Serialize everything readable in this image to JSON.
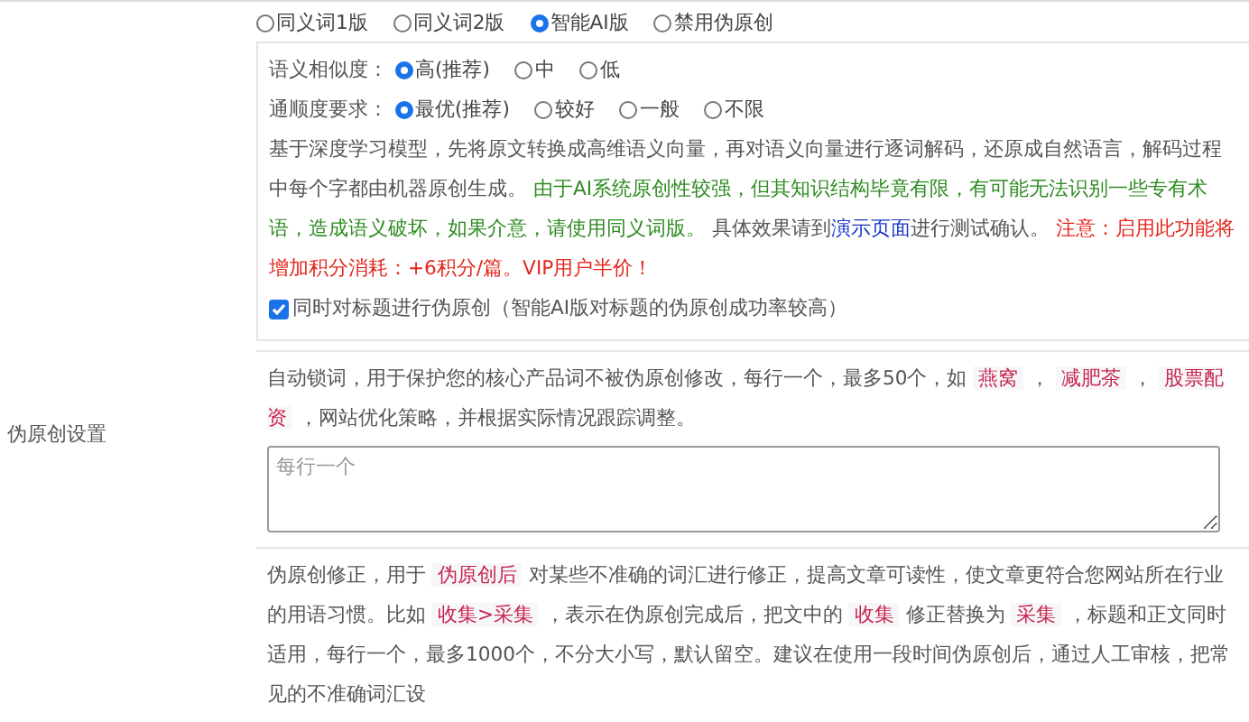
{
  "version_options": [
    {
      "label": "同义词1版",
      "selected": false
    },
    {
      "label": "同义词2版",
      "selected": false
    },
    {
      "label": "智能AI版",
      "selected": true
    },
    {
      "label": "禁用伪原创",
      "selected": false
    }
  ],
  "settings_panel": {
    "option_groups": [
      {
        "label": "语义相似度：",
        "options": [
          {
            "label": "高(推荐)",
            "selected": true
          },
          {
            "label": "中",
            "selected": false
          },
          {
            "label": "低",
            "selected": false
          }
        ]
      },
      {
        "label": "通顺度要求：",
        "options": [
          {
            "label": "最优(推荐)",
            "selected": true
          },
          {
            "label": "较好",
            "selected": false
          },
          {
            "label": "一般",
            "selected": false
          },
          {
            "label": "不限",
            "selected": false
          }
        ]
      }
    ],
    "description": [
      {
        "kind": "plain",
        "text": "基于深度学习模型，先将原文转换成高维语义向量，再对语义向量进行逐词解码，还原成自然语言，解码过程中每个字都由机器原创生成。 "
      },
      {
        "kind": "green",
        "text": "由于AI系统原创性较强，但其知识结构毕竟有限，有可能无法识别一些专有术语，造成语义破坏，如果介意，请使用同义词版。"
      },
      {
        "kind": "plain",
        "text": " 具体效果请到"
      },
      {
        "kind": "link",
        "text": "演示页面"
      },
      {
        "kind": "plain",
        "text": "进行测试确认。 "
      },
      {
        "kind": "red",
        "text": "注意：启用此功能将增加积分消耗：+6积分/篇。VIP用户半价！"
      }
    ],
    "title_option": {
      "label": "同时对标题进行伪原创（智能AI版对标题的伪原创成功率较高）",
      "checked": true
    }
  },
  "lock_words": {
    "label": "伪原创设置",
    "description": [
      {
        "kind": "plain",
        "text": "自动锁词，用于保护您的核心产品词不被伪原创修改，每行一个，最多50个，如 "
      },
      {
        "kind": "code",
        "text": "燕窝"
      },
      {
        "kind": "plain",
        "text": " ， "
      },
      {
        "kind": "code",
        "text": "减肥茶"
      },
      {
        "kind": "plain",
        "text": " ， "
      },
      {
        "kind": "code",
        "text": "股票配资"
      },
      {
        "kind": "plain",
        "text": " ，网站优化策略，并根据实际情况跟踪调整。"
      }
    ],
    "textarea": {
      "placeholder": "每行一个"
    }
  },
  "correction": {
    "description": [
      {
        "kind": "plain",
        "text": "伪原创修正，用于 "
      },
      {
        "kind": "code",
        "text": "伪原创后"
      },
      {
        "kind": "plain",
        "text": " 对某些不准确的词汇进行修正，提高文章可读性，使文章更符合您网站所在行业的用语习惯。比如 "
      },
      {
        "kind": "code",
        "text": "收集>采集"
      },
      {
        "kind": "plain",
        "text": " ，表示在伪原创完成后，把文中的 "
      },
      {
        "kind": "code",
        "text": "收集"
      },
      {
        "kind": "plain",
        "text": " 修正替换为 "
      },
      {
        "kind": "code",
        "text": "采集"
      },
      {
        "kind": "plain",
        "text": " ，标题和正文同时适用，每行一个，最多1000个，不分大小写，默认留空。建议在使用一段时间伪原创后，通过人工审核，把常见的不准确词汇设"
      }
    ]
  }
}
